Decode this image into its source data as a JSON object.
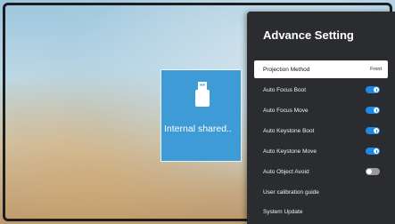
{
  "storage_tile": {
    "label": "Internal shared..",
    "icon": "usb-drive-icon"
  },
  "panel": {
    "title": "Advance Setting",
    "items": [
      {
        "label": "Projection Method",
        "value": "Front",
        "selected": true
      },
      {
        "label": "Auto Focus Boot",
        "toggle": "on"
      },
      {
        "label": "Auto Focus Move",
        "toggle": "on"
      },
      {
        "label": "Auto Keystone Boot",
        "toggle": "on"
      },
      {
        "label": "Auto Keystone Move",
        "toggle": "on"
      },
      {
        "label": "Auto Object Avoid",
        "toggle": "off"
      },
      {
        "label": "User calibration guide"
      },
      {
        "label": "System Update"
      }
    ]
  },
  "colors": {
    "accent": "#1f88e0",
    "tile": "#3f9bd6",
    "panel": "#2a2c30"
  }
}
